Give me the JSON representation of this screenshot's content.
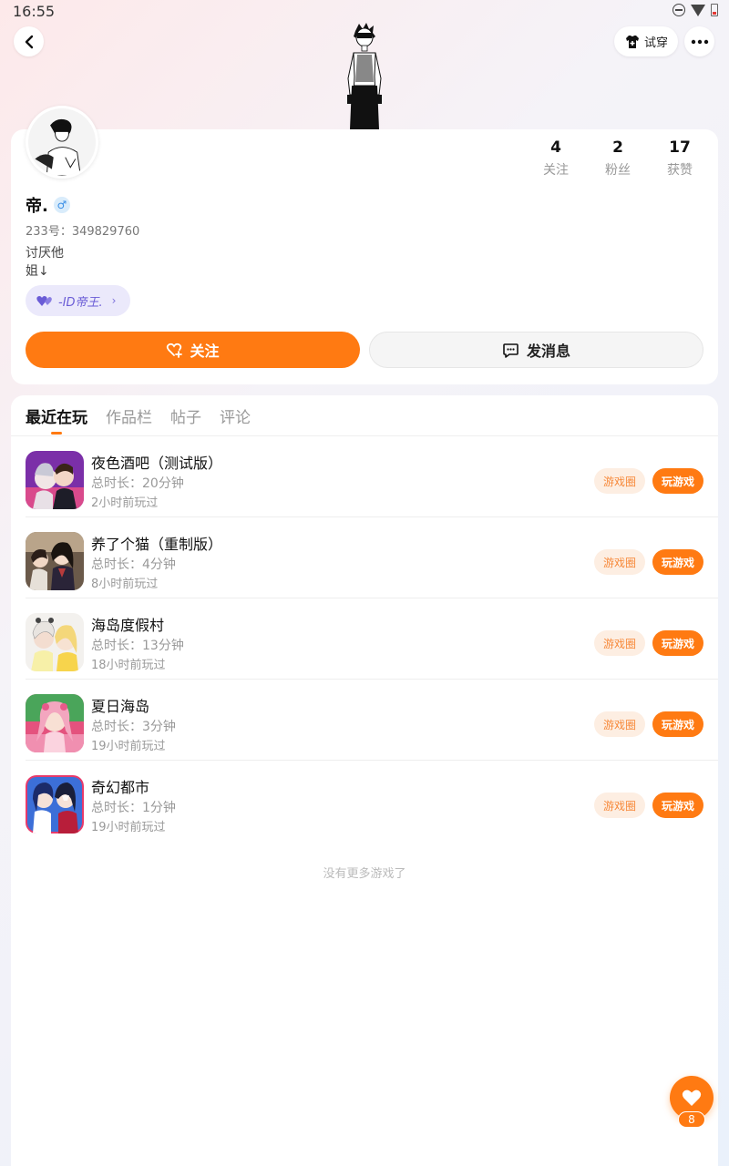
{
  "status_bar": {
    "time": "16:55"
  },
  "header": {
    "tryon_label": "试穿"
  },
  "profile": {
    "name": "帝.",
    "gender_symbol": "♂",
    "uid": "233号：349829760",
    "bio_line1": "讨厌他",
    "bio_line2": "姐↓",
    "tag_label": "-ID帝王.",
    "stats": [
      {
        "value": "4",
        "label": "关注"
      },
      {
        "value": "2",
        "label": "粉丝"
      },
      {
        "value": "17",
        "label": "获赞"
      }
    ],
    "follow_label": "关注",
    "message_label": "发消息"
  },
  "tabs": [
    {
      "label": "最近在玩",
      "active": true
    },
    {
      "label": "作品栏",
      "active": false
    },
    {
      "label": "帖子",
      "active": false
    },
    {
      "label": "评论",
      "active": false
    }
  ],
  "games": [
    {
      "title": "夜色酒吧（测试版）",
      "duration": "总时长：20分钟",
      "last_played": "2小时前玩过",
      "circle_label": "游戏圈",
      "play_label": "玩游戏"
    },
    {
      "title": "养了个猫（重制版）",
      "duration": "总时长：4分钟",
      "last_played": "8小时前玩过",
      "circle_label": "游戏圈",
      "play_label": "玩游戏"
    },
    {
      "title": "海岛度假村",
      "duration": "总时长：13分钟",
      "last_played": "18小时前玩过",
      "circle_label": "游戏圈",
      "play_label": "玩游戏"
    },
    {
      "title": "夏日海岛",
      "duration": "总时长：3分钟",
      "last_played": "19小时前玩过",
      "circle_label": "游戏圈",
      "play_label": "玩游戏"
    },
    {
      "title": "奇幻都市",
      "duration": "总时长：1分钟",
      "last_played": "19小时前玩过",
      "circle_label": "游戏圈",
      "play_label": "玩游戏"
    }
  ],
  "no_more_text": "没有更多游戏了",
  "like_count": "8",
  "colors": {
    "accent": "#ff7a12",
    "tag_bg": "#ebe9fb",
    "tag_text": "#6a5cd6",
    "circle_bg": "#fdeee2"
  }
}
